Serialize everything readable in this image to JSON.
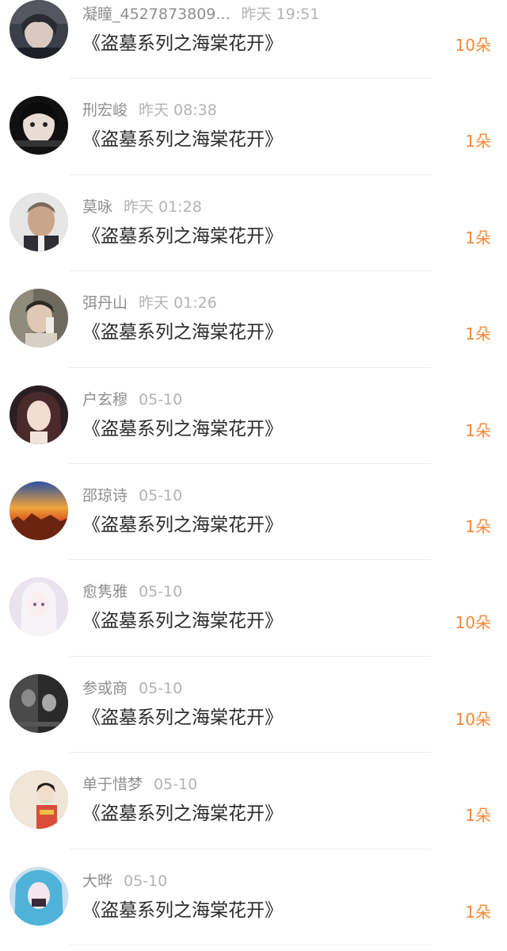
{
  "items": [
    {
      "name": "凝瞳_4527873809...",
      "time": "昨天 19:51",
      "title": "《盗墓系列之海棠花开》",
      "count": "10朵",
      "avatar": "avatar-dark-anime"
    },
    {
      "name": "刑宏峻",
      "time": "昨天 08:38",
      "title": "《盗墓系列之海棠花开》",
      "count": "1朵",
      "avatar": "avatar-girl-face"
    },
    {
      "name": "莫咏",
      "time": "昨天 01:28",
      "title": "《盗墓系列之海棠花开》",
      "count": "1朵",
      "avatar": "avatar-man-portrait"
    },
    {
      "name": "弭丹山",
      "time": "昨天 01:26",
      "title": "《盗墓系列之海棠花开》",
      "count": "1朵",
      "avatar": "avatar-boy-phone"
    },
    {
      "name": "户玄穆",
      "time": "05-10",
      "title": "《盗墓系列之海棠花开》",
      "count": "1朵",
      "avatar": "avatar-girl-photo"
    },
    {
      "name": "邵琼诗",
      "time": "05-10",
      "title": "《盗墓系列之海棠花开》",
      "count": "1朵",
      "avatar": "avatar-sunset"
    },
    {
      "name": "愈隽雅",
      "time": "05-10",
      "title": "《盗墓系列之海棠花开》",
      "count": "10朵",
      "avatar": "avatar-white-anime"
    },
    {
      "name": "参或商",
      "time": "05-10",
      "title": "《盗墓系列之海棠花开》",
      "count": "10朵",
      "avatar": "avatar-bw-couple"
    },
    {
      "name": "单于惜梦",
      "time": "05-10",
      "title": "《盗墓系列之海棠花开》",
      "count": "1朵",
      "avatar": "avatar-girl-kimono"
    },
    {
      "name": "大晔",
      "time": "05-10",
      "title": "《盗墓系列之海棠花开》",
      "count": "1朵",
      "avatar": "avatar-blue-anime"
    }
  ]
}
